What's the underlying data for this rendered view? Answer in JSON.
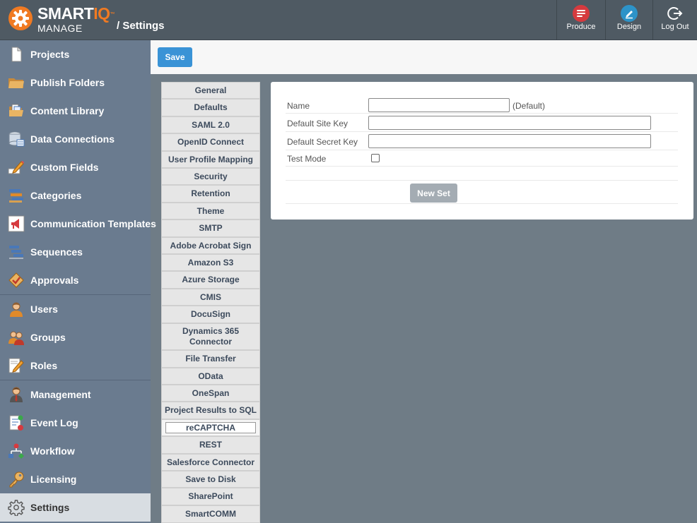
{
  "header": {
    "brand": "SMART",
    "brand_accent": "IQ",
    "brand_tm": "™",
    "brand_sub": "MANAGE",
    "breadcrumb": "/ Settings",
    "buttons": [
      {
        "label": "Produce",
        "icon": "produce-icon",
        "color": "#d63a3f"
      },
      {
        "label": "Design",
        "icon": "design-icon",
        "color": "#2d93c8"
      },
      {
        "label": "Log Out",
        "icon": "logout-icon"
      }
    ]
  },
  "sidebar": {
    "items": [
      {
        "label": "Projects",
        "icon": "document-icon"
      },
      {
        "label": "Publish Folders",
        "icon": "folder-icon"
      },
      {
        "label": "Content Library",
        "icon": "content-library-icon"
      },
      {
        "label": "Data Connections",
        "icon": "database-icon"
      },
      {
        "label": "Custom Fields",
        "icon": "pencil-icon"
      },
      {
        "label": "Categories",
        "icon": "categories-icon"
      },
      {
        "label": "Communication Templates",
        "icon": "megaphone-icon"
      },
      {
        "label": "Sequences",
        "icon": "sequences-icon"
      },
      {
        "label": "Approvals",
        "icon": "approval-icon"
      },
      {
        "label": "Users",
        "icon": "user-icon"
      },
      {
        "label": "Groups",
        "icon": "group-icon"
      },
      {
        "label": "Roles",
        "icon": "role-icon"
      },
      {
        "label": "Management",
        "icon": "manager-icon"
      },
      {
        "label": "Event Log",
        "icon": "event-log-icon"
      },
      {
        "label": "Workflow",
        "icon": "workflow-icon"
      },
      {
        "label": "Licensing",
        "icon": "key-icon"
      },
      {
        "label": "Settings",
        "icon": "gear-icon"
      }
    ],
    "active": "Settings"
  },
  "toolbar": {
    "save_label": "Save"
  },
  "tabs": [
    "General",
    "Defaults",
    "SAML 2.0",
    "OpenID Connect",
    "User Profile Mapping",
    "Security",
    "Retention",
    "Theme",
    "SMTP",
    "Adobe Acrobat Sign",
    "Amazon S3",
    "Azure Storage",
    "CMIS",
    "DocuSign",
    "Dynamics 365 Connector",
    "File Transfer",
    "OData",
    "OneSpan",
    "Project Results to SQL",
    "reCAPTCHA",
    "REST",
    "Salesforce Connector",
    "Save to Disk",
    "SharePoint",
    "SmartCOMM"
  ],
  "active_tab": "reCAPTCHA",
  "form": {
    "name_label": "Name",
    "name_value": "",
    "name_hint": "(Default)",
    "site_key_label": "Default Site Key",
    "site_key_value": "",
    "secret_key_label": "Default Secret Key",
    "secret_key_value": "",
    "test_mode_label": "Test Mode",
    "test_mode_checked": false,
    "new_set_label": "New Set"
  }
}
